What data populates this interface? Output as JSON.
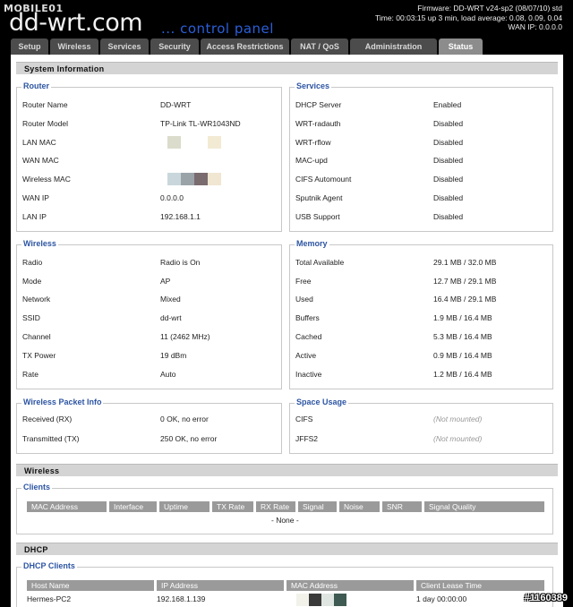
{
  "header": {
    "logo_top": "MOBILE01",
    "brand": "dd-wrt.com",
    "subtitle": "... control panel",
    "firmware": "Firmware: DD-WRT v24-sp2 (08/07/10) std",
    "time": "Time: 00:03:15 up 3 min, load average: 0.08, 0.09, 0.04",
    "wan_ip": "WAN IP: 0.0.0.0"
  },
  "tabs": [
    "Setup",
    "Wireless",
    "Services",
    "Security",
    "Access Restrictions",
    "NAT / QoS",
    "Administration",
    "Status"
  ],
  "active_tab": "Status",
  "system_info": {
    "title": "System Information",
    "router": {
      "legend": "Router",
      "rows": [
        {
          "k": "Router Name",
          "v": "DD-WRT"
        },
        {
          "k": "Router Model",
          "v": "TP-Link TL-WR1043ND"
        },
        {
          "k": "LAN MAC",
          "v": ""
        },
        {
          "k": "WAN MAC",
          "v": ""
        },
        {
          "k": "Wireless MAC",
          "v": ""
        },
        {
          "k": "WAN IP",
          "v": "0.0.0.0"
        },
        {
          "k": "LAN IP",
          "v": "192.168.1.1"
        }
      ]
    },
    "services": {
      "legend": "Services",
      "rows": [
        {
          "k": "DHCP Server",
          "v": "Enabled"
        },
        {
          "k": "WRT-radauth",
          "v": "Disabled"
        },
        {
          "k": "WRT-rflow",
          "v": "Disabled"
        },
        {
          "k": "MAC-upd",
          "v": "Disabled"
        },
        {
          "k": "CIFS Automount",
          "v": "Disabled"
        },
        {
          "k": "Sputnik Agent",
          "v": "Disabled"
        },
        {
          "k": "USB Support",
          "v": "Disabled"
        }
      ]
    },
    "wireless": {
      "legend": "Wireless",
      "rows": [
        {
          "k": "Radio",
          "v": "Radio is On"
        },
        {
          "k": "Mode",
          "v": "AP"
        },
        {
          "k": "Network",
          "v": "Mixed"
        },
        {
          "k": "SSID",
          "v": "dd-wrt"
        },
        {
          "k": "Channel",
          "v": "11 (2462 MHz)"
        },
        {
          "k": "TX Power",
          "v": "19 dBm"
        },
        {
          "k": "Rate",
          "v": "Auto"
        }
      ]
    },
    "memory": {
      "legend": "Memory",
      "rows": [
        {
          "k": "Total Available",
          "v": "29.1 MB / 32.0 MB"
        },
        {
          "k": "Free",
          "v": "12.7 MB / 29.1 MB"
        },
        {
          "k": "Used",
          "v": "16.4 MB / 29.1 MB"
        },
        {
          "k": "Buffers",
          "v": "1.9 MB / 16.4 MB"
        },
        {
          "k": "Cached",
          "v": "5.3 MB / 16.4 MB"
        },
        {
          "k": "Active",
          "v": "0.9 MB / 16.4 MB"
        },
        {
          "k": "Inactive",
          "v": "1.2 MB / 16.4 MB"
        }
      ]
    },
    "packet_info": {
      "legend": "Wireless Packet Info",
      "rows": [
        {
          "k": "Received (RX)",
          "v": "0 OK, no error"
        },
        {
          "k": "Transmitted (TX)",
          "v": "250 OK, no error"
        }
      ]
    },
    "space_usage": {
      "legend": "Space Usage",
      "rows": [
        {
          "k": "CIFS",
          "v": "(Not mounted)"
        },
        {
          "k": "JFFS2",
          "v": "(Not mounted)"
        }
      ]
    }
  },
  "wireless_section": {
    "title": "Wireless",
    "clients_legend": "Clients",
    "columns": [
      "MAC Address",
      "Interface",
      "Uptime",
      "TX Rate",
      "RX Rate",
      "Signal",
      "Noise",
      "SNR",
      "Signal Quality"
    ],
    "empty": "- None -"
  },
  "dhcp_section": {
    "title": "DHCP",
    "clients_legend": "DHCP Clients",
    "columns": [
      "Host Name",
      "IP Address",
      "MAC Address",
      "Client Lease Time"
    ],
    "rows": [
      {
        "host": "Hermes-PC2",
        "ip": "192.168.1.139",
        "mac": "",
        "lease": "1 day 00:00:00"
      }
    ]
  },
  "watermark": "#1160389",
  "colors": {
    "accent": "#2d55a3",
    "tab_bg": "#4c4c4c",
    "section_bg": "#d4d4d4",
    "table_head": "#9a9a9a",
    "brand_blue": "#2b5fd9"
  }
}
